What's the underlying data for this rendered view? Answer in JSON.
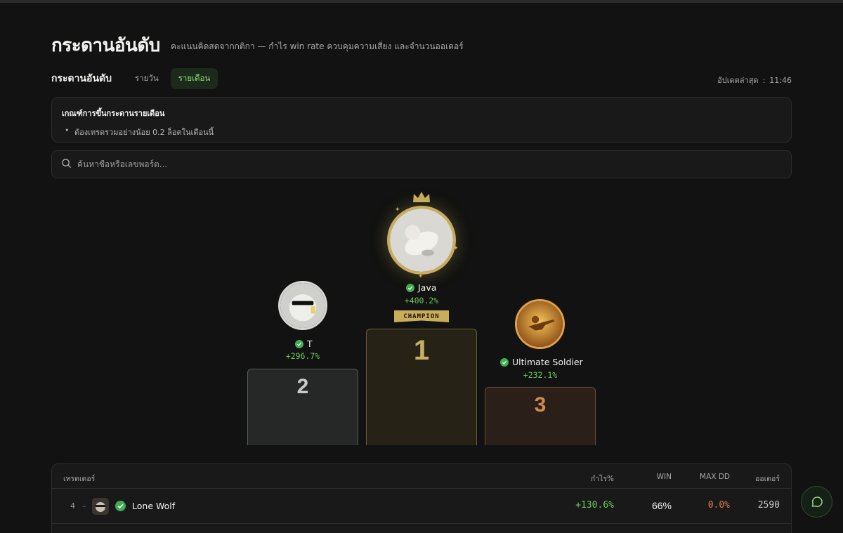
{
  "header": {
    "title": "กระดานอันดับ",
    "subtitle": "คะแนนคิดสดจากกติกา — กำไร win rate ควบคุมความเสี่ยง และจำนวนออเดอร์"
  },
  "tabs": {
    "label": "กระดานอันดับ",
    "items": [
      "รายวัน",
      "รายเดือน"
    ],
    "active": "รายเดือน"
  },
  "updated": {
    "label": "อัปเดตล่าสุด",
    "separator": ":",
    "time": "11:46"
  },
  "criteria": {
    "title": "เกณฑ์การขึ้นกระดานรายเดือน",
    "items": [
      "ต้องเทรดรวมอย่างน้อย 0.2 ล็อตในเดือนนี้"
    ]
  },
  "search": {
    "placeholder": "ค้นหาชื่อหรือเลขพอร์ต..."
  },
  "podium": {
    "first": {
      "rank": "1",
      "name": "Java",
      "profit": "+400.2%",
      "badge": "CHAMPION"
    },
    "second": {
      "rank": "2",
      "name": "T",
      "profit": "+296.7%"
    },
    "third": {
      "rank": "3",
      "name": "Ultimate Soldier",
      "profit": "+232.1%"
    }
  },
  "table": {
    "columns": {
      "trader": "เทรดเดอร์",
      "profit": "กำไร%",
      "win": "WIN",
      "max_dd": "MAX DD",
      "orders": "ออเดอร์"
    },
    "rows": [
      {
        "rank": "4",
        "trend": "–",
        "name": "Lone Wolf",
        "profit": "+130.6%",
        "win": "66%",
        "max_dd": "0.0%",
        "orders": "2590"
      }
    ]
  },
  "colors": {
    "accent_green": "#6fc95b",
    "gold": "#c9ad5b",
    "silver": "#c9cac8",
    "bronze": "#d08a4e",
    "drawdown": "#e07a52"
  },
  "icons": [
    "search-icon",
    "crown-icon",
    "verified-badge-icon",
    "chat-icon"
  ]
}
